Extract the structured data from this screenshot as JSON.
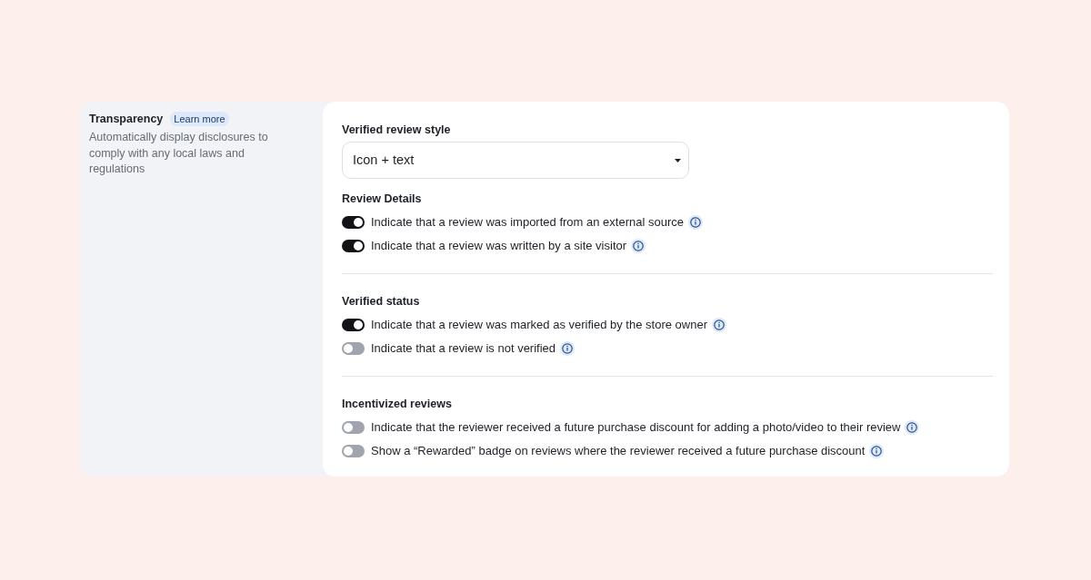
{
  "section": {
    "title": "Transparency",
    "link": "Learn more",
    "description": "Automatically display disclosures to comply with any local laws and regulations"
  },
  "style_field": {
    "label": "Verified review style",
    "value": "Icon + text"
  },
  "groups": [
    {
      "title": "Review Details",
      "options": [
        {
          "label": "Indicate that a review was imported from an external source",
          "on": true
        },
        {
          "label": "Indicate that a review was written by a site visitor",
          "on": true
        }
      ]
    },
    {
      "title": "Verified status",
      "options": [
        {
          "label": "Indicate that a review was marked as verified by the store owner",
          "on": true
        },
        {
          "label": "Indicate that a review is not verified",
          "on": false
        }
      ]
    },
    {
      "title": "Incentivized reviews",
      "options": [
        {
          "label": "Indicate that the reviewer received a future purchase discount for adding a photo/video to their review",
          "on": false
        },
        {
          "label": "Show a “Rewarded” badge on reviews where the reviewer received a future purchase discount",
          "on": false
        }
      ]
    }
  ]
}
